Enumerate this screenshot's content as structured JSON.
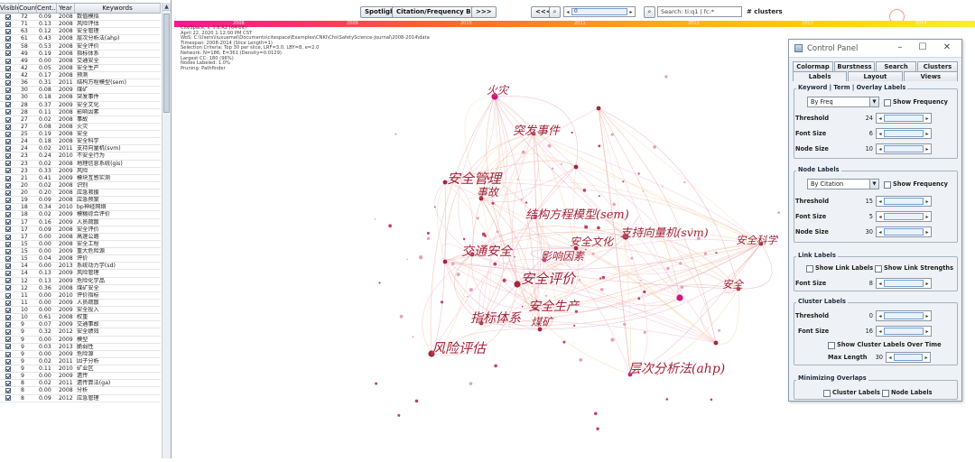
{
  "table": {
    "columns": [
      "Visible",
      "Count",
      "Cent...",
      "Year",
      "Keywords"
    ],
    "rows": [
      [
        "72",
        "0.09",
        "2008",
        "数值模拟"
      ],
      [
        "71",
        "0.13",
        "2008",
        "风险评估"
      ],
      [
        "63",
        "0.12",
        "2008",
        "安全管理"
      ],
      [
        "61",
        "0.43",
        "2008",
        "层次分析法(ahp)"
      ],
      [
        "58",
        "0.53",
        "2008",
        "安全评价"
      ],
      [
        "49",
        "0.19",
        "2008",
        "指标体系"
      ],
      [
        "49",
        "0.00",
        "2008",
        "交通安全"
      ],
      [
        "42",
        "0.05",
        "2008",
        "安全生产"
      ],
      [
        "42",
        "0.17",
        "2008",
        "预测"
      ],
      [
        "36",
        "0.31",
        "2011",
        "结构方程模型(sem)"
      ],
      [
        "30",
        "0.08",
        "2009",
        "煤矿"
      ],
      [
        "30",
        "0.18",
        "2008",
        "突发事件"
      ],
      [
        "28",
        "0.37",
        "2009",
        "安全文化"
      ],
      [
        "28",
        "0.11",
        "2008",
        "影响因素"
      ],
      [
        "27",
        "0.02",
        "2008",
        "事故"
      ],
      [
        "27",
        "0.08",
        "2008",
        "火灾"
      ],
      [
        "25",
        "0.19",
        "2008",
        "安全"
      ],
      [
        "24",
        "0.18",
        "2008",
        "安全科学"
      ],
      [
        "24",
        "0.02",
        "2011",
        "支持向量机(svm)"
      ],
      [
        "23",
        "0.24",
        "2010",
        "不安全行为"
      ],
      [
        "23",
        "0.02",
        "2008",
        "地理信息系统(gis)"
      ],
      [
        "23",
        "0.33",
        "2009",
        "风险"
      ],
      [
        "21",
        "0.41",
        "2009",
        "模块互感实测"
      ],
      [
        "20",
        "0.02",
        "2008",
        "识别"
      ],
      [
        "20",
        "0.20",
        "2008",
        "应急救援"
      ],
      [
        "19",
        "0.09",
        "2008",
        "应急预案"
      ],
      [
        "18",
        "0.34",
        "2010",
        "bp神经网络"
      ],
      [
        "18",
        "0.02",
        "2009",
        "模糊综合评价"
      ],
      [
        "17",
        "0.16",
        "2009",
        "人员疏散"
      ],
      [
        "17",
        "0.09",
        "2008",
        "安全评价"
      ],
      [
        "17",
        "0.00",
        "2008",
        "高速公路"
      ],
      [
        "15",
        "0.00",
        "2008",
        "安全工程"
      ],
      [
        "15",
        "0.00",
        "2009",
        "重大危险源"
      ],
      [
        "15",
        "0.04",
        "2008",
        "评价"
      ],
      [
        "14",
        "0.00",
        "2013",
        "系统动力学(sd)"
      ],
      [
        "14",
        "0.13",
        "2009",
        "风险管理"
      ],
      [
        "12",
        "0.13",
        "2009",
        "危险化学品"
      ],
      [
        "12",
        "0.36",
        "2008",
        "煤矿安全"
      ],
      [
        "11",
        "0.00",
        "2010",
        "评价指标"
      ],
      [
        "11",
        "0.00",
        "2009",
        "人员疏散"
      ],
      [
        "10",
        "0.00",
        "2009",
        "安全投入"
      ],
      [
        "10",
        "0.61",
        "2008",
        "权重"
      ],
      [
        "9",
        "0.07",
        "2009",
        "交通事故"
      ],
      [
        "9",
        "0.32",
        "2012",
        "安全绩效"
      ],
      [
        "9",
        "0.00",
        "2009",
        "模型"
      ],
      [
        "9",
        "0.03",
        "2013",
        "脆弱性"
      ],
      [
        "9",
        "0.00",
        "2009",
        "危险源"
      ],
      [
        "9",
        "0.02",
        "2011",
        "因子分析"
      ],
      [
        "9",
        "0.11",
        "2010",
        "矿业区"
      ],
      [
        "9",
        "0.00",
        "2009",
        "遗传"
      ],
      [
        "8",
        "0.02",
        "2011",
        "遗传算法(ga)"
      ],
      [
        "8",
        "0.00",
        "2008",
        "分析"
      ],
      [
        "8",
        "0.09",
        "2012",
        "应急管理"
      ]
    ]
  },
  "toolbar": {
    "spotlight": "Spotlight",
    "citation_burst": "Citation/Frequency Burst",
    "expand": ">>>",
    "prev": "<<<",
    "zoom_icon": "magnifier-icon",
    "slider_value": "0",
    "search_placeholder": "Search: ti:q1 | fc:*",
    "clusters_label": "# clusters"
  },
  "timeline": {
    "years": [
      "2008",
      "2009",
      "2010",
      "2011",
      "2012",
      "2013",
      "2014"
    ]
  },
  "info": {
    "lines": [
      "CiteSpace, v. 5.6.R2 (64-bit)",
      "April 22, 2020 1:12:00 PM CST",
      "WoS: C:\\Users\\liuxuemei\\Documents\\citespace\\Examples\\CNKI\\Chs\\SafetyScience-Journal\\2008-2014\\data",
      "Timespan: 2008-2014 (Slice Length=1)",
      "Selection Criteria: Top 30 per slice, LRF=3.0, LBY=8, e=2.0",
      "Network: N=186, E=361 (Density=0.0129)",
      "Largest CC: 180 (96%)",
      "Nodes Labeled: 1.0%",
      "Pruning: Pathfinder"
    ]
  },
  "graph": {
    "keywords": [
      {
        "text": "火灾"
      },
      {
        "text": "突发事件"
      },
      {
        "text": "安全管理"
      },
      {
        "text": "事故"
      },
      {
        "text": "结构方程模型(sem)"
      },
      {
        "text": "支持向量机(svm)"
      },
      {
        "text": "安全文化"
      },
      {
        "text": "交通安全"
      },
      {
        "text": "影响因素"
      },
      {
        "text": "安全科学"
      },
      {
        "text": "安全评价"
      },
      {
        "text": "安全"
      },
      {
        "text": "安全生产"
      },
      {
        "text": "指标体系"
      },
      {
        "text": "煤矿"
      },
      {
        "text": "风险评估"
      },
      {
        "text": "层次分析法(ahp)"
      }
    ]
  },
  "control_panel": {
    "title": "Control Panel",
    "tabs_row1": [
      "Colormap",
      "Burstness",
      "Search",
      "Clusters"
    ],
    "tabs_row2": [
      "Labels",
      "Layout",
      "Views"
    ],
    "keyword_section": {
      "title": "Keyword | Term | Overlay Labels",
      "sort_by": "By Freq",
      "show_frequency": "Show Frequency",
      "threshold_label": "Threshold",
      "threshold": "24",
      "font_size_label": "Font Size",
      "font_size": "6",
      "node_size_label": "Node Size",
      "node_size": "10"
    },
    "node_section": {
      "title": "Node Labels",
      "sort_by": "By Citation",
      "show_frequency": "Show Frequency",
      "threshold_label": "Threshold",
      "threshold": "15",
      "font_size_label": "Font Size",
      "font_size": "5",
      "node_size_label": "Node Size",
      "node_size": "30"
    },
    "link_section": {
      "title": "Link Labels",
      "show_link_labels": "Show Link Labels",
      "show_link_strengths": "Show Link Strengths",
      "font_size_label": "Font Size",
      "font_size": "8"
    },
    "cluster_section": {
      "title": "Cluster Labels",
      "threshold_label": "Threshold",
      "threshold": "0",
      "font_size_label": "Font Size",
      "font_size": "16",
      "show_over_time": "Show Cluster Labels Over Time",
      "max_length_label": "Max Length",
      "max_length": "30"
    },
    "overlap_section": {
      "title": "Minimizing Overlaps",
      "cluster_labels": "Cluster Labels",
      "node_labels": "Node Labels"
    },
    "window_controls": [
      "minimize-icon",
      "maximize-icon",
      "close-icon"
    ]
  }
}
